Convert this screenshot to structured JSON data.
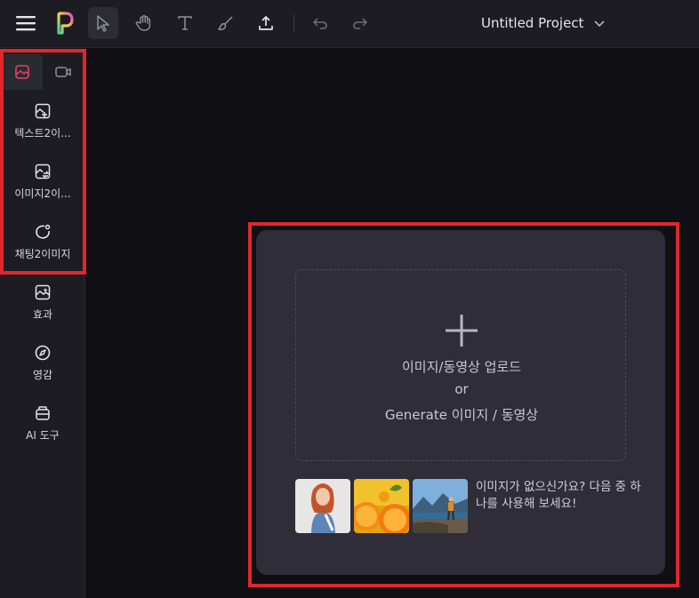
{
  "topbar": {
    "project_title": "Untitled Project",
    "tools": [
      "menu-icon",
      "logo",
      "select-tool-icon",
      "hand-tool-icon",
      "text-tool-icon",
      "brush-tool-icon",
      "upload-icon",
      "undo-icon",
      "redo-icon"
    ]
  },
  "sidebar": {
    "tabs": [
      "image-tab-icon",
      "video-tab-icon"
    ],
    "items": [
      {
        "label": "텍스트2이...",
        "icon": "image-plus-icon"
      },
      {
        "label": "이미지2이...",
        "icon": "image-swap-icon"
      },
      {
        "label": "채팅2이미지",
        "icon": "chat-icon"
      },
      {
        "label": "효과",
        "icon": "image-effect-icon"
      },
      {
        "label": "영감",
        "icon": "compass-icon"
      },
      {
        "label": "AI 도구",
        "icon": "toolbox-icon"
      }
    ]
  },
  "upload": {
    "line1": "이미지/동영상 업로드",
    "line2": "or",
    "line3": "Generate 이미지 / 동영상",
    "hint": "이미지가 없으신가요? 다음 중 하나를 사용해 보세요!"
  },
  "colors": {
    "accent": "#e5416a",
    "highlight_border": "#e3262e",
    "panel": "#2e2d38",
    "background": "#0f0f14"
  }
}
